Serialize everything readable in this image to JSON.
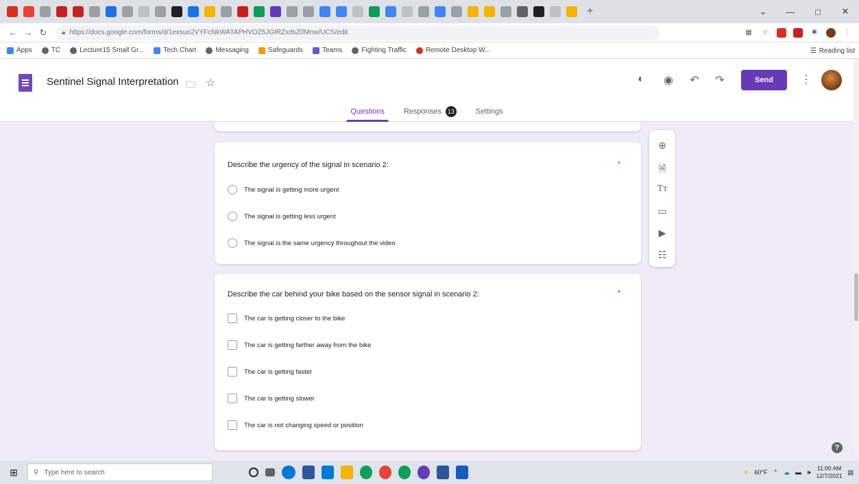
{
  "browser": {
    "url": "https://docs.google.com/forms/d/1exsuo2VYFcNkWATAPHVOZ5JGIRZxdsZ0Mnw/UCS/edit",
    "bookmarks": [
      "Apps",
      "TC",
      "Lecture15 Small Gr...",
      "Tech Chart",
      "Messaging",
      "Safeguards",
      "Teams",
      "Fighting Traffic",
      "Remote Desktop W..."
    ],
    "reading_list": "Reading list",
    "window_controls": {
      "minimize": "—",
      "maximize": "□",
      "close": "✕"
    }
  },
  "form": {
    "title": "Sentinel Signal Interpretation",
    "send_label": "Send",
    "tabs": {
      "questions": "Questions",
      "responses": "Responses",
      "responses_count": "13",
      "settings": "Settings"
    }
  },
  "questions": [
    {
      "title": "Describe the urgency of the signal in scenario 2:",
      "required_mark": "*",
      "type": "radio",
      "options": [
        "The signal is getting more urgent",
        "The signal is getting less urgent",
        "The signal is the same urgency throughout the video"
      ]
    },
    {
      "title": "Describe the car behind your bike based on the sensor signal in scenario 2:",
      "required_mark": "*",
      "type": "checkbox",
      "options": [
        "The car is getting closer to the bike",
        "The car is getting farther away from the bike",
        "The car is getting faster",
        "The car is getting slower",
        "The car is not changing speed or position"
      ]
    }
  ],
  "taskbar": {
    "search_placeholder": "Type here to search",
    "weather": "60°F",
    "time": "11:00 AM",
    "date": "12/7/2021"
  },
  "colors": {
    "accent": "#673ab7",
    "background": "#f0ebf8"
  }
}
